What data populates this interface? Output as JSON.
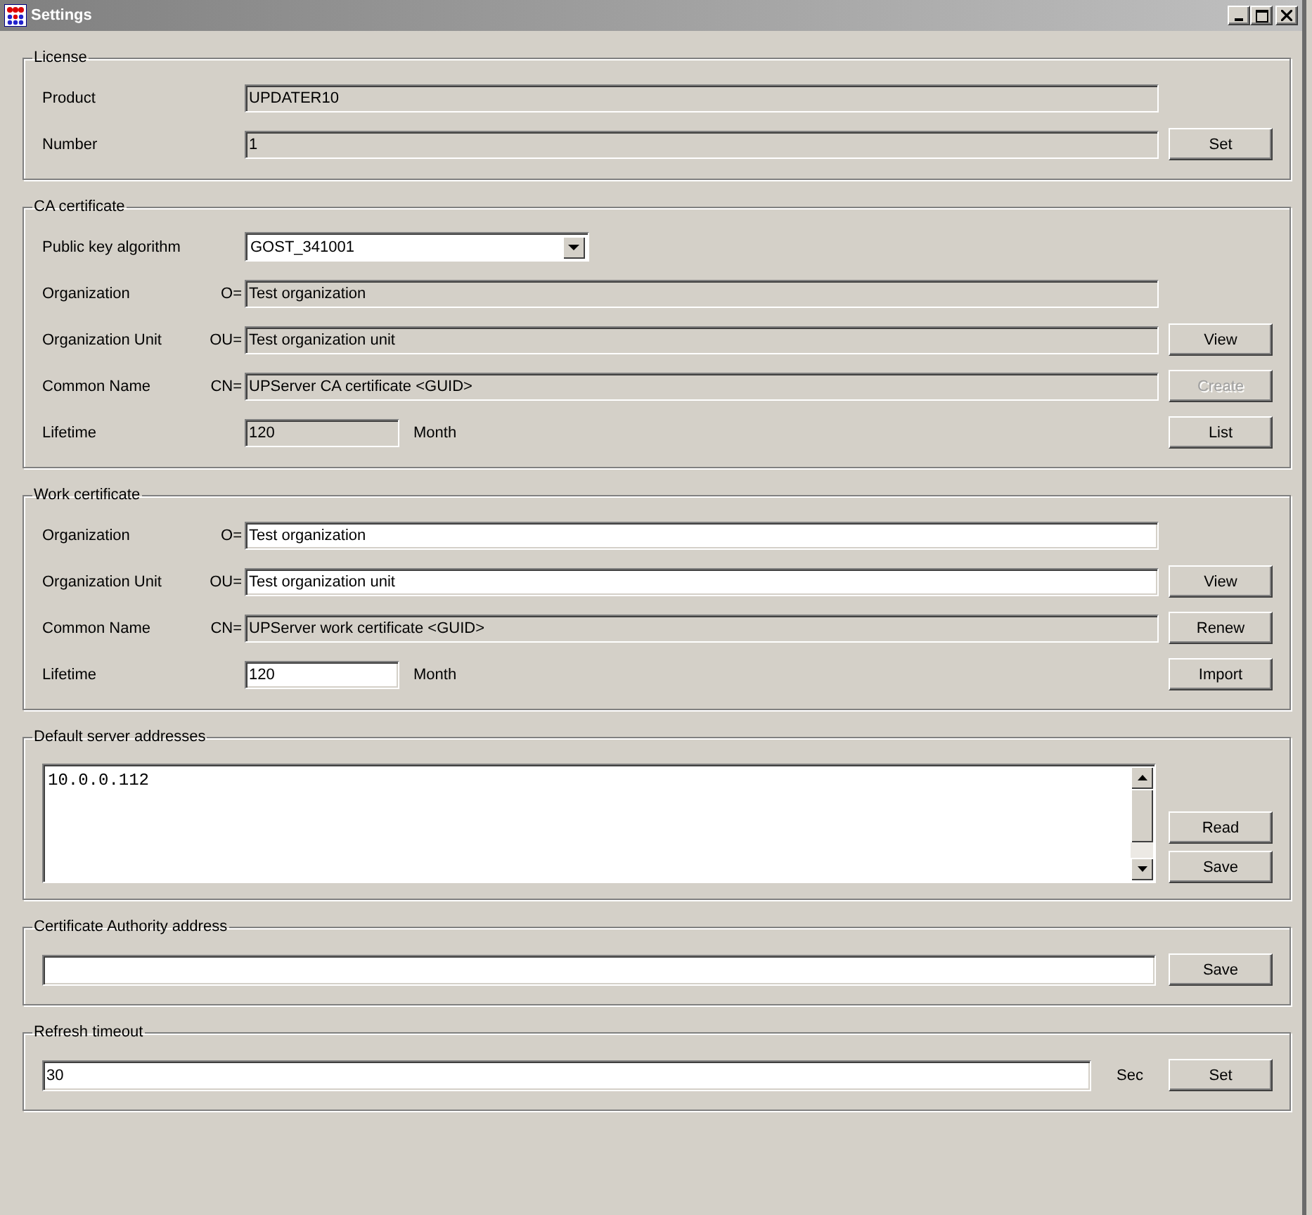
{
  "window": {
    "title": "Settings"
  },
  "groups": [
    {
      "kind": "form",
      "title": "License",
      "rows": [
        {
          "label": "Product",
          "field": {
            "kind": "text",
            "value": "UPDATER10",
            "readonly": true
          }
        },
        {
          "label": "Number",
          "field": {
            "kind": "text",
            "value": "1",
            "readonly": true
          },
          "button": {
            "label": "Set",
            "disabled": false
          }
        }
      ]
    },
    {
      "kind": "form",
      "title": "CA certificate",
      "rows": [
        {
          "label": "Public key algorithm",
          "field": {
            "kind": "dropdown",
            "value": "GOST_341001",
            "readonly": false
          }
        },
        {
          "label": "Organization",
          "prefix": "O=",
          "field": {
            "kind": "text",
            "value": "Test organization",
            "readonly": true
          }
        },
        {
          "label": "Organization Unit",
          "prefix": "OU=",
          "field": {
            "kind": "text",
            "value": "Test organization unit",
            "readonly": true
          },
          "button": {
            "label": "View",
            "disabled": false
          }
        },
        {
          "label": "Common Name",
          "prefix": "CN=",
          "field": {
            "kind": "text",
            "value": "UPServer CA certificate <GUID>",
            "readonly": true
          },
          "button": {
            "label": "Create",
            "disabled": true
          }
        },
        {
          "label": "Lifetime",
          "field": {
            "kind": "short",
            "value": "120",
            "readonly": true
          },
          "unit": "Month",
          "button": {
            "label": "List",
            "disabled": false
          }
        }
      ]
    },
    {
      "kind": "form",
      "title": "Work certificate",
      "rows": [
        {
          "label": "Organization",
          "prefix": "O=",
          "field": {
            "kind": "text",
            "value": "Test organization",
            "readonly": false
          }
        },
        {
          "label": "Organization Unit",
          "prefix": "OU=",
          "field": {
            "kind": "text",
            "value": "Test organization unit",
            "readonly": false
          },
          "button": {
            "label": "View",
            "disabled": false
          }
        },
        {
          "label": "Common Name",
          "prefix": "CN=",
          "field": {
            "kind": "text",
            "value": "UPServer work certificate <GUID>",
            "readonly": true
          },
          "button": {
            "label": "Renew",
            "disabled": false
          }
        },
        {
          "label": "Lifetime",
          "field": {
            "kind": "short",
            "value": "120",
            "readonly": false
          },
          "unit": "Month",
          "button": {
            "label": "Import",
            "disabled": false
          }
        }
      ]
    },
    {
      "kind": "textarea",
      "title": "Default server addresses",
      "value": "10.0.0.112",
      "buttons": [
        {
          "label": "Read",
          "disabled": false
        },
        {
          "label": "Save",
          "disabled": false
        }
      ]
    },
    {
      "kind": "single",
      "title": "Certificate Authority address",
      "field": {
        "readonly": false
      },
      "buttons": [
        {
          "label": "Save",
          "disabled": false
        }
      ]
    },
    {
      "kind": "single",
      "title": "Refresh timeout",
      "field": {
        "value": "30",
        "readonly": false
      },
      "unit": "Sec",
      "buttons": [
        {
          "label": "Set",
          "disabled": false
        }
      ]
    }
  ]
}
